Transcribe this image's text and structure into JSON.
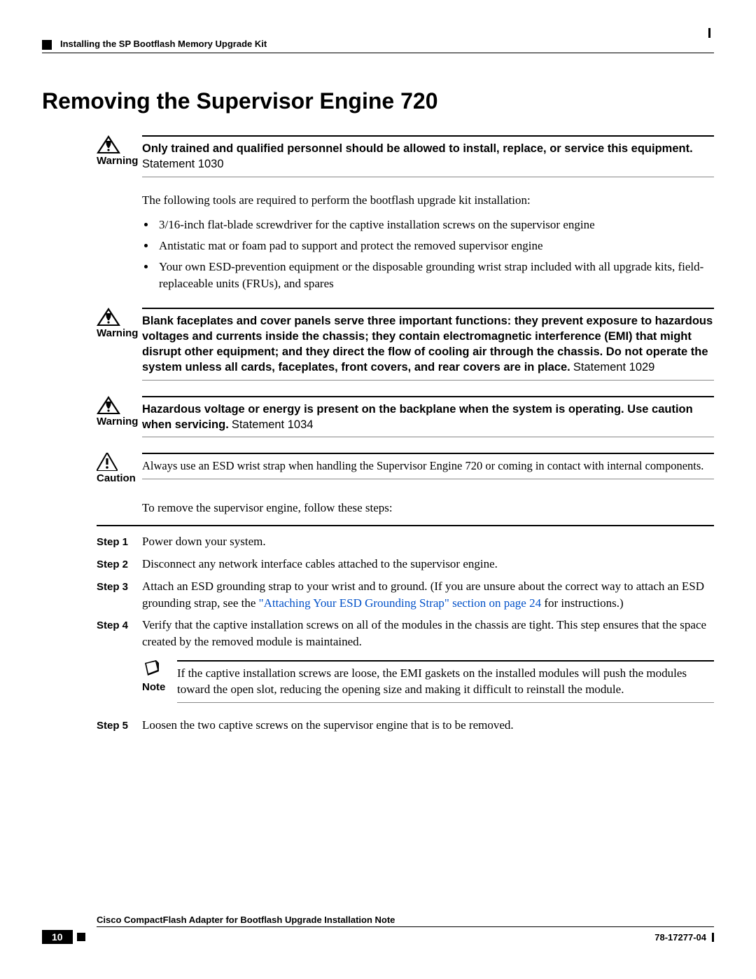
{
  "header": {
    "section": "Installing the SP Bootflash Memory Upgrade Kit"
  },
  "title": "Removing the Supervisor Engine 720",
  "warnings": [
    {
      "label": "Warning",
      "bold": "Only trained and qualified personnel should be allowed to install, replace, or service this equipment.",
      "statement": "Statement 1030"
    },
    {
      "label": "Warning",
      "bold": "Blank faceplates and cover panels serve three important functions: they prevent exposure to hazardous voltages and currents inside the chassis; they contain electromagnetic interference (EMI) that might disrupt other equipment; and they direct the flow of cooling air through the chassis. Do not operate the system unless all cards, faceplates, front covers, and rear covers are in place.",
      "statement": "Statement 1029"
    },
    {
      "label": "Warning",
      "bold": "Hazardous voltage or energy is present on the backplane when the system is operating. Use caution when servicing.",
      "statement": "Statement 1034"
    }
  ],
  "intro": "The following tools are required to perform the bootflash upgrade kit installation:",
  "tools": [
    "3/16-inch flat-blade screwdriver for the captive installation screws on the supervisor engine",
    "Antistatic mat or foam pad to support and protect the removed supervisor engine",
    "Your own ESD-prevention equipment or the disposable grounding wrist strap included with all upgrade kits, field-replaceable units (FRUs), and spares"
  ],
  "caution": {
    "label": "Caution",
    "text": "Always use an ESD wrist strap when handling the Supervisor Engine 720 or coming in contact with internal components."
  },
  "lead": "To remove the supervisor engine, follow these steps:",
  "steps": [
    {
      "label": "Step 1",
      "text": "Power down your system."
    },
    {
      "label": "Step 2",
      "text": "Disconnect any network interface cables attached to the supervisor engine."
    },
    {
      "label": "Step 3",
      "pre": "Attach an ESD grounding strap to your wrist and to ground. (If you are unsure about the correct way to attach an ESD grounding strap, see the ",
      "link": "\"Attaching Your ESD Grounding Strap\" section on page 24",
      "post": " for instructions.)"
    },
    {
      "label": "Step 4",
      "text": "Verify that the captive installation screws on all of the modules in the chassis are tight. This step ensures that the space created by the removed module is maintained."
    },
    {
      "label": "Step 5",
      "text": "Loosen the two captive screws on the supervisor engine that is to be removed."
    }
  ],
  "note": {
    "label": "Note",
    "text": "If the captive installation screws are loose, the EMI gaskets on the installed modules will push the modules toward the open slot, reducing the opening size and making it difficult to reinstall the module."
  },
  "footer": {
    "doc": "Cisco CompactFlash Adapter for Bootflash Upgrade Installation Note",
    "page": "10",
    "partnum": "78-17277-04"
  }
}
